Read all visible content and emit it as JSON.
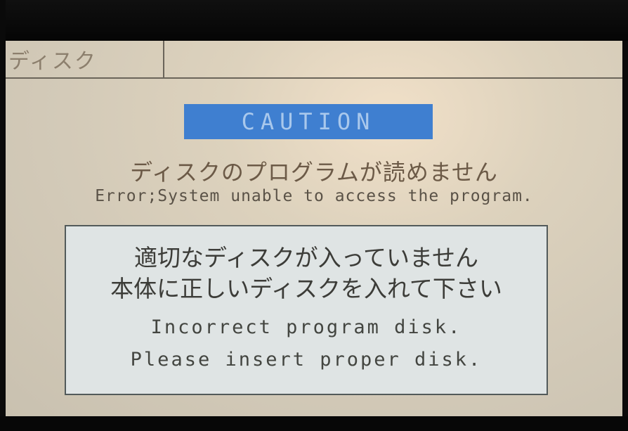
{
  "header": {
    "tab_label": "ディスク"
  },
  "caution": {
    "label": "CAUTION"
  },
  "error": {
    "message_jp": "ディスクのプログラムが読めません",
    "message_en": "Error;System unable to access the program."
  },
  "dialog": {
    "line1_jp": "適切なディスクが入っていません",
    "line2_jp": "本体に正しいディスクを入れて下さい",
    "line1_en": "Incorrect program disk.",
    "line2_en": "Please insert proper disk."
  },
  "colors": {
    "caution_bg": "#3f7fd0",
    "screen_bg": "#d6ccb9",
    "dialog_bg": "#dfe4e4"
  }
}
